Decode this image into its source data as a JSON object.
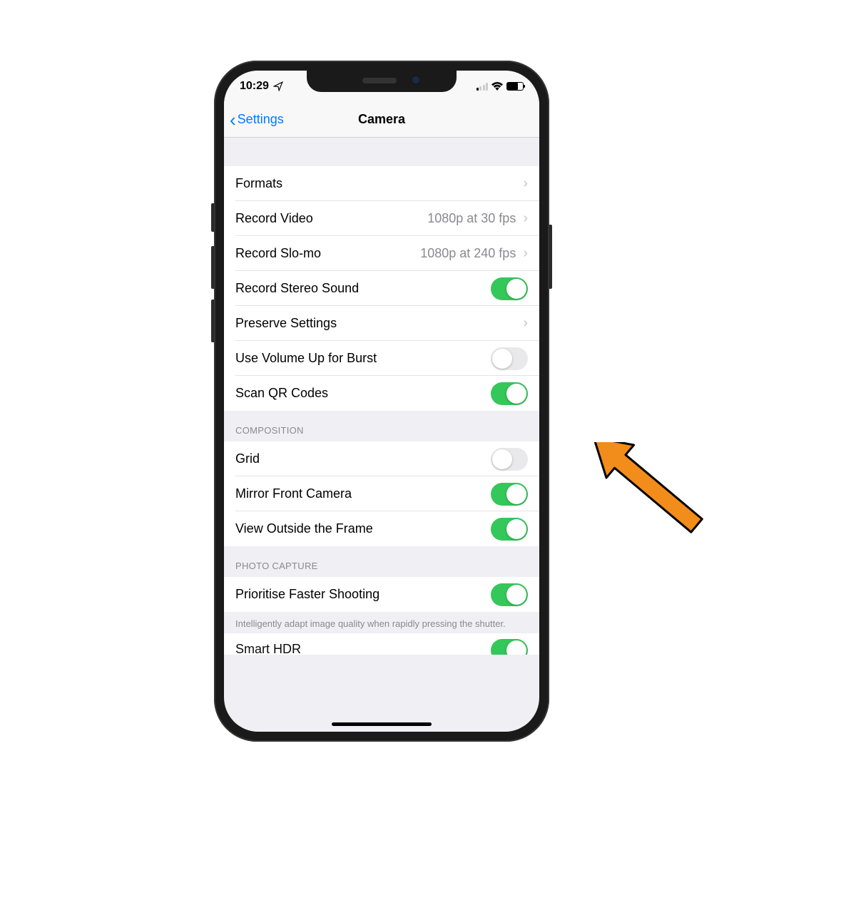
{
  "status": {
    "time": "10:29",
    "location_indicator": "➤"
  },
  "nav": {
    "back_label": "Settings",
    "title": "Camera"
  },
  "group1": {
    "formats": {
      "label": "Formats"
    },
    "record_video": {
      "label": "Record Video",
      "value": "1080p at 30 fps"
    },
    "record_slomo": {
      "label": "Record Slo-mo",
      "value": "1080p at 240 fps"
    },
    "stereo_sound": {
      "label": "Record Stereo Sound",
      "on": true
    },
    "preserve": {
      "label": "Preserve Settings"
    },
    "volume_burst": {
      "label": "Use Volume Up for Burst",
      "on": false
    },
    "scan_qr": {
      "label": "Scan QR Codes",
      "on": true
    }
  },
  "group2": {
    "header": "COMPOSITION",
    "grid": {
      "label": "Grid",
      "on": false
    },
    "mirror": {
      "label": "Mirror Front Camera",
      "on": true
    },
    "view_outside": {
      "label": "View Outside the Frame",
      "on": true
    }
  },
  "group3": {
    "header": "PHOTO CAPTURE",
    "prioritise": {
      "label": "Prioritise Faster Shooting",
      "on": true
    },
    "footer": "Intelligently adapt image quality when rapidly pressing the shutter.",
    "smart_hdr": {
      "label": "Smart HDR",
      "on": true
    }
  }
}
